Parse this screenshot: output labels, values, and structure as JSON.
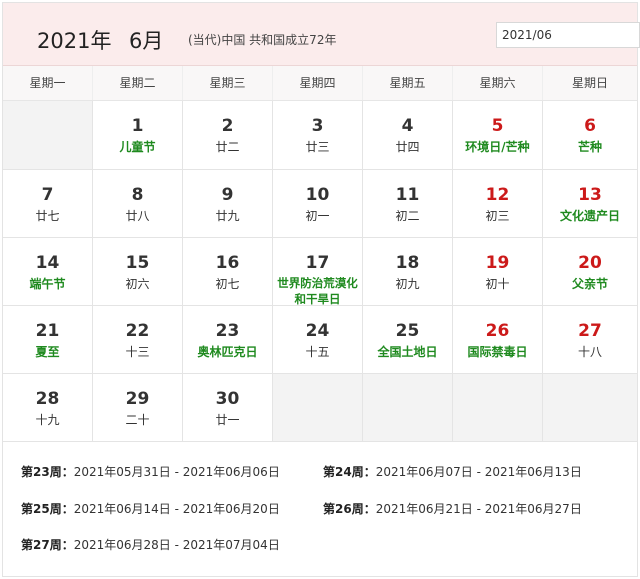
{
  "header": {
    "year": "2021年",
    "month": "6月",
    "era": "(当代)中国 共和国成立72年",
    "date_input_value": "2021/06"
  },
  "weekdays": [
    "星期一",
    "星期二",
    "星期三",
    "星期四",
    "星期五",
    "星期六",
    "星期日"
  ],
  "days": [
    {
      "empty": true
    },
    {
      "num": "1",
      "sub": "儿童节",
      "holiday": true,
      "red": false
    },
    {
      "num": "2",
      "sub": "廿二",
      "holiday": false,
      "red": false
    },
    {
      "num": "3",
      "sub": "廿三",
      "holiday": false,
      "red": false
    },
    {
      "num": "4",
      "sub": "廿四",
      "holiday": false,
      "red": false
    },
    {
      "num": "5",
      "sub": "环境日/芒种",
      "holiday": true,
      "red": true
    },
    {
      "num": "6",
      "sub": "芒种",
      "holiday": true,
      "red": true
    },
    {
      "num": "7",
      "sub": "廿七",
      "holiday": false,
      "red": false
    },
    {
      "num": "8",
      "sub": "廿八",
      "holiday": false,
      "red": false
    },
    {
      "num": "9",
      "sub": "廿九",
      "holiday": false,
      "red": false
    },
    {
      "num": "10",
      "sub": "初一",
      "holiday": false,
      "red": false
    },
    {
      "num": "11",
      "sub": "初二",
      "holiday": false,
      "red": false
    },
    {
      "num": "12",
      "sub": "初三",
      "holiday": false,
      "red": true
    },
    {
      "num": "13",
      "sub": "文化遗产日",
      "holiday": true,
      "red": true
    },
    {
      "num": "14",
      "sub": "端午节",
      "holiday": true,
      "red": false
    },
    {
      "num": "15",
      "sub": "初六",
      "holiday": false,
      "red": false
    },
    {
      "num": "16",
      "sub": "初七",
      "holiday": false,
      "red": false
    },
    {
      "num": "17",
      "sub": "世界防治荒漠化和干旱日",
      "holiday": true,
      "red": false
    },
    {
      "num": "18",
      "sub": "初九",
      "holiday": false,
      "red": false
    },
    {
      "num": "19",
      "sub": "初十",
      "holiday": false,
      "red": true
    },
    {
      "num": "20",
      "sub": "父亲节",
      "holiday": true,
      "red": true
    },
    {
      "num": "21",
      "sub": "夏至",
      "holiday": true,
      "red": false
    },
    {
      "num": "22",
      "sub": "十三",
      "holiday": false,
      "red": false
    },
    {
      "num": "23",
      "sub": "奥林匹克日",
      "holiday": true,
      "red": false
    },
    {
      "num": "24",
      "sub": "十五",
      "holiday": false,
      "red": false
    },
    {
      "num": "25",
      "sub": "全国土地日",
      "holiday": true,
      "red": false
    },
    {
      "num": "26",
      "sub": "国际禁毒日",
      "holiday": true,
      "red": true
    },
    {
      "num": "27",
      "sub": "十八",
      "holiday": false,
      "red": true
    },
    {
      "num": "28",
      "sub": "十九",
      "holiday": false,
      "red": false
    },
    {
      "num": "29",
      "sub": "二十",
      "holiday": false,
      "red": false
    },
    {
      "num": "30",
      "sub": "廿一",
      "holiday": false,
      "red": false
    },
    {
      "empty": true
    },
    {
      "empty": true
    },
    {
      "empty": true
    },
    {
      "empty": true
    }
  ],
  "weeks": [
    {
      "label": "第23周：",
      "range": "2021年05月31日 - 2021年06月06日"
    },
    {
      "label": "第24周：",
      "range": "2021年06月07日 - 2021年06月13日"
    },
    {
      "label": "第25周：",
      "range": "2021年06月14日 - 2021年06月20日"
    },
    {
      "label": "第26周：",
      "range": "2021年06月21日 - 2021年06月27日"
    },
    {
      "label": "第27周：",
      "range": "2021年06月28日 - 2021年07月04日"
    }
  ],
  "colors": {
    "header_bg": "#fbecec",
    "weekend_red": "#cc1a1a",
    "holiday_green": "#1f8a1f",
    "empty_cell": "#f3f3f3"
  }
}
